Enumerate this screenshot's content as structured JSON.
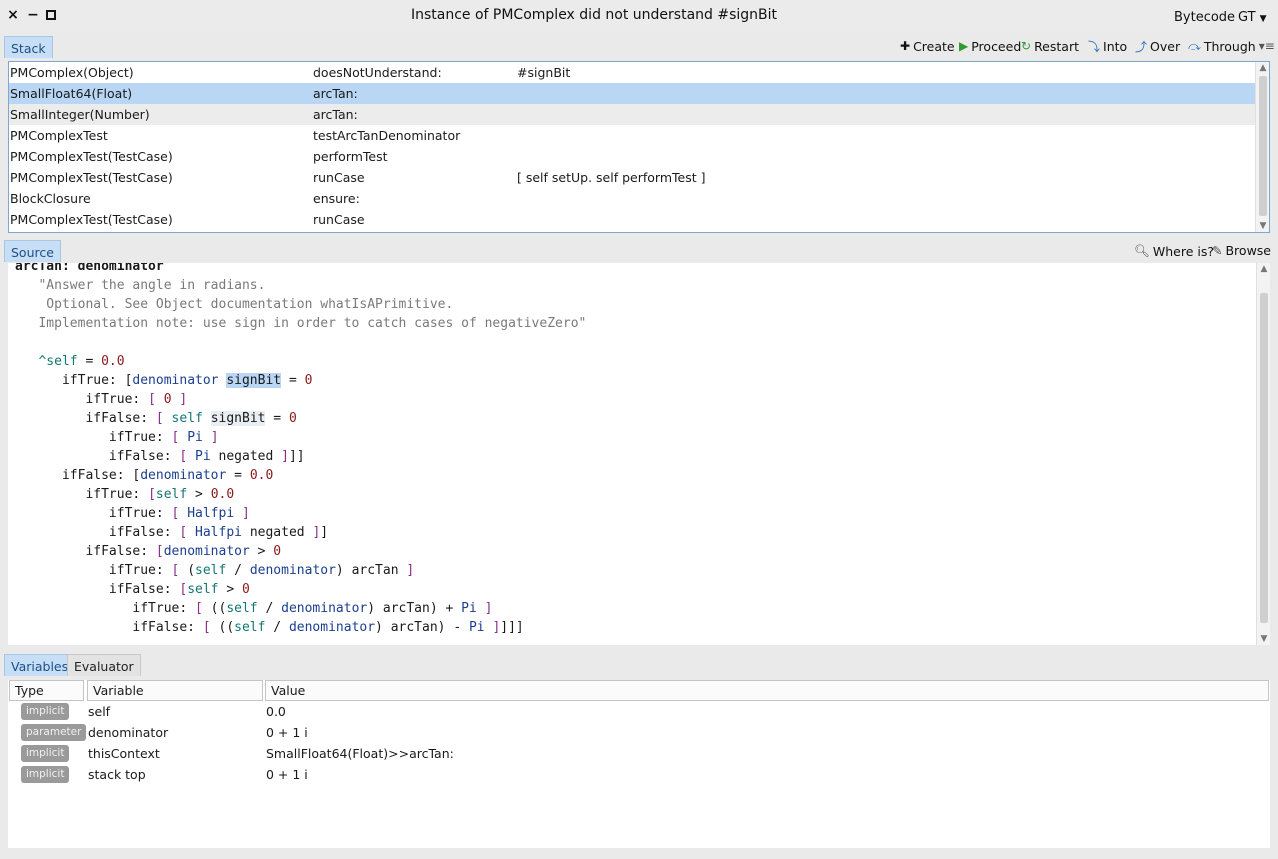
{
  "window": {
    "title": "Instance of PMComplex did not understand #signBit",
    "close_glyph": "×",
    "min_glyph": "−",
    "right_bytecode": "Bytecode",
    "right_gt": "GT",
    "right_gt_caret": "▼"
  },
  "stack_panel": {
    "tab_label": "Stack",
    "toolbar": {
      "create": "Create",
      "proceed": "Proceed",
      "restart": "Restart",
      "into": "Into",
      "over": "Over",
      "through": "Through"
    },
    "rows": [
      {
        "receiver": "PMComplex(Object)",
        "selector": "doesNotUnderstand:",
        "detail": "#signBit"
      },
      {
        "receiver": "SmallFloat64(Float)",
        "selector": "arcTan:",
        "detail": ""
      },
      {
        "receiver": "SmallInteger(Number)",
        "selector": "arcTan:",
        "detail": ""
      },
      {
        "receiver": "PMComplexTest",
        "selector": "testArcTanDenominator",
        "detail": ""
      },
      {
        "receiver": "PMComplexTest(TestCase)",
        "selector": "performTest",
        "detail": ""
      },
      {
        "receiver": "PMComplexTest(TestCase)",
        "selector": "runCase",
        "detail": "[ self setUp. self performTest ]"
      },
      {
        "receiver": "BlockClosure",
        "selector": "ensure:",
        "detail": ""
      },
      {
        "receiver": "PMComplexTest(TestCase)",
        "selector": "runCase",
        "detail": ""
      }
    ],
    "selected_row": 1
  },
  "source_panel": {
    "tab_label": "Source",
    "where_is_label": "Where is?",
    "browse_label": "Browse",
    "method_header": "arcTan: denominator"
  },
  "inspector": {
    "tabs": [
      "Variables",
      "Evaluator"
    ],
    "active_tab": "Variables",
    "columns": {
      "type": "Type",
      "variable": "Variable",
      "value": "Value"
    },
    "rows": [
      {
        "type": "implicit",
        "variable": "self",
        "value": "0.0"
      },
      {
        "type": "parameter",
        "variable": "denominator",
        "value": "0 + 1 i"
      },
      {
        "type": "implicit",
        "variable": "thisContext",
        "value": "SmallFloat64(Float)>>arcTan:"
      },
      {
        "type": "implicit",
        "variable": "stack top",
        "value": "0 + 1 i"
      }
    ]
  },
  "colors": {
    "selection": "#b9d7f5",
    "active_tab": "#c6dff6",
    "badge": "#9a9a9a"
  }
}
